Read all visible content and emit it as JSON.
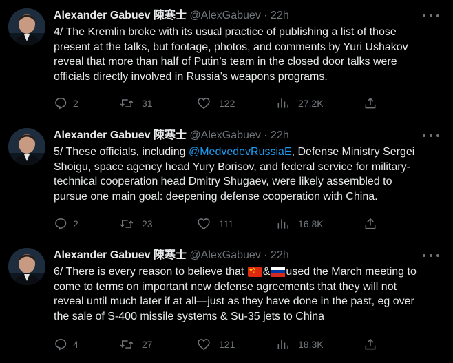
{
  "tweets": [
    {
      "author": "Alexander Gabuev 陳寒士",
      "handle": "@AlexGabuev",
      "sep": "·",
      "time": "22h",
      "text_lines": [
        "4/ The Kremlin broke with its usual practice of publishing a list of those",
        "present at the talks, but footage, photos, and comments by Yuri Ushakov",
        "reveal that more than half of Putin’s team in the closed door talks were",
        "officials directly involved in Russia’s weapons programs."
      ],
      "replies": "2",
      "retweets": "31",
      "likes": "122",
      "views": "27.2K"
    },
    {
      "author": "Alexander Gabuev 陳寒士",
      "handle": "@AlexGabuev",
      "sep": "·",
      "time": "22h",
      "line1_prefix": "5/ These officials, including ",
      "mention": "@MedvedevRussiaE",
      "line1_suffix": ", Defense Ministry Sergei",
      "text_lines_rest": [
        "Shoigu, space agency head Yury Borisov, and federal service for military-",
        "technical cooperation head Dmitry Shugaev, were likely assembled to",
        "pursue one main goal: deepening defense cooperation with China."
      ],
      "replies": "2",
      "retweets": "23",
      "likes": "111",
      "views": "16.8K"
    },
    {
      "author": "Alexander Gabuev 陳寒士",
      "handle": "@AlexGabuev",
      "sep": "·",
      "time": "22h",
      "line1_prefix": "6/ There is every reason to believe that ",
      "line1_amp": "&",
      "line1_suffix": "used the March meeting to",
      "text_lines_rest": [
        "come to terms on important new defense agreements that they will not",
        "reveal until much later if at all—just as they have done in the past, eg over",
        "the sale of S-400 missile systems & Su-35 jets to China"
      ],
      "replies": "4",
      "retweets": "27",
      "likes": "121",
      "views": "18.3K"
    }
  ],
  "icons": [
    "reply-icon",
    "retweet-icon",
    "like-icon",
    "views-icon",
    "share-icon",
    "more-icon",
    "china-flag-icon",
    "russia-flag-icon"
  ],
  "colors": {
    "background": "#000000",
    "text": "#e7e9ea",
    "muted": "#71767b",
    "link": "#1d9bf0"
  }
}
